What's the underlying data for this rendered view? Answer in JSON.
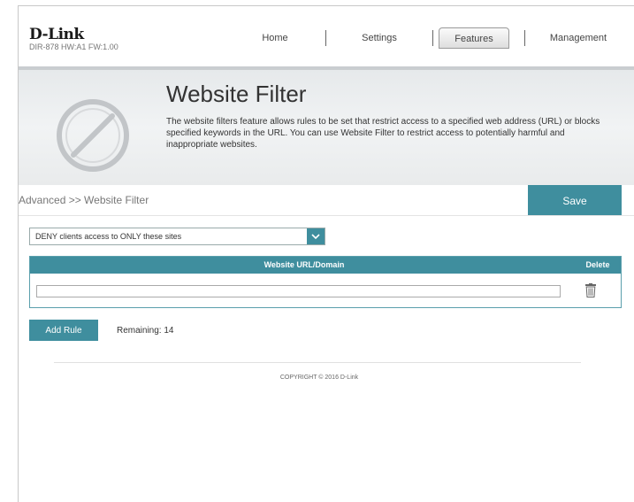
{
  "logo": {
    "brand": "D-Link",
    "device_info": "DIR-878 HW:A1 FW:1.00"
  },
  "nav": {
    "items": [
      "Home",
      "Settings",
      "Features",
      "Management"
    ],
    "active": "Features"
  },
  "hero": {
    "title": "Website Filter",
    "description": "The website filters feature allows rules to be set that restrict access to a specified web address (URL) or blocks specified keywords in the URL. You can use Website Filter to restrict access to potentially harmful and inappropriate websites.",
    "icon": "disabled-circle-icon"
  },
  "breadcrumb": "Advanced >> Website Filter",
  "save_label": "Save",
  "filter_mode": {
    "selected": "DENY clients access to ONLY these sites",
    "icon": "chevron-down-icon"
  },
  "table": {
    "columns": [
      "Website URL/Domain",
      "Delete"
    ],
    "rows": [
      {
        "url": "",
        "delete_icon": "trash-icon"
      }
    ]
  },
  "add_rule_label": "Add Rule",
  "remaining_text": "Remaining: 14",
  "copyright": "COPYRIGHT © 2016 D-Link",
  "colors": {
    "accent": "#3f8e9e",
    "hero_bg": "#eef0f1"
  }
}
